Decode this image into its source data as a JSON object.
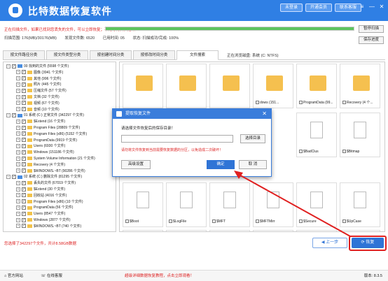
{
  "app": {
    "title": "比特数据恢复软件"
  },
  "titlebar": {
    "buttons": [
      "未登录",
      "开通会员",
      "联系客服"
    ],
    "win_controls": [
      "≡",
      "—",
      "✕"
    ]
  },
  "scan": {
    "status": "正在扫描文件，如果已找到您丢失的文件，可以立即恢复；不用等待扫描结束！",
    "progress": 1.0,
    "details": [
      "扫描范围: 176(MB)/30176(MB)",
      "发现文件数: 6520",
      "已用时间: 05",
      "状态: 扫描成功/完成: 100%"
    ],
    "pause_btn": "暂停扫描",
    "save_btn": "保存进度"
  },
  "tabs": [
    "按文件路径分类",
    "按文件类型分类",
    "按创建时间分类",
    "按修改时间分类",
    "文件搜索"
  ],
  "current_position": "正在浏览磁盘: 系统 (C: NTFS)",
  "tree": [
    {
      "label": "00 找到的文件 (5598 个文件)",
      "level": 0,
      "type": "blue"
    },
    {
      "label": "图像 (3941 个文件)",
      "level": 1,
      "type": "folder"
    },
    {
      "label": "其他 (996 个文件)",
      "level": 1,
      "type": "folder"
    },
    {
      "label": "照片 (445 个文件)",
      "level": 1,
      "type": "folder"
    },
    {
      "label": "压缩文件 (57 个文件)",
      "level": 1,
      "type": "folder"
    },
    {
      "label": "文档 (32 个文件)",
      "level": 1,
      "type": "folder"
    },
    {
      "label": "视频 (67 个文件)",
      "level": 1,
      "type": "folder"
    },
    {
      "label": "音频 (10 个文件)",
      "level": 1,
      "type": "folder"
    },
    {
      "label": "01 系统 (C:) 正常文件 (342297 个文件)",
      "level": 0,
      "type": "blue"
    },
    {
      "label": "$Extend (16 个文件)",
      "level": 1,
      "type": "folder"
    },
    {
      "label": "Program Files (28809 个文件)",
      "level": 1,
      "type": "folder"
    },
    {
      "label": "Program Files (x86) (5152 个文件)",
      "level": 1,
      "type": "folder"
    },
    {
      "label": "ProgramData (9919 个文件)",
      "level": 1,
      "type": "folder"
    },
    {
      "label": "Users (6930 个文件)",
      "level": 1,
      "type": "folder"
    },
    {
      "label": "Windows (151186 个文件)",
      "level": 1,
      "type": "folder"
    },
    {
      "label": "System Volume Information (21 个文件)",
      "level": 1,
      "type": "folder"
    },
    {
      "label": "Recovery (4 个文件)",
      "level": 1,
      "type": "folder"
    },
    {
      "label": "$WINDOWS.~BT (90286 个文件)",
      "level": 1,
      "type": "folder"
    },
    {
      "label": "02 系统 (C:) 删除文件 (81295 个文件)",
      "level": 0,
      "type": "blue"
    },
    {
      "label": "丢失的文件 (67019 个文件)",
      "level": 1,
      "type": "folder"
    },
    {
      "label": "$Extend (30 个文件)",
      "level": 1,
      "type": "folder"
    },
    {
      "label": "回收站 (4016 个文件)",
      "level": 1,
      "type": "folder"
    },
    {
      "label": "Program Files (x86) (10 个文件)",
      "level": 1,
      "type": "folder"
    },
    {
      "label": "ProgramData (56 个文件)",
      "level": 1,
      "type": "folder"
    },
    {
      "label": "Users (8547 个文件)",
      "level": 1,
      "type": "folder"
    },
    {
      "label": "Windows (2877 个文件)",
      "level": 1,
      "type": "folder"
    },
    {
      "label": "$WINDOWS.~BT (740 个文件)",
      "level": 1,
      "type": "folder"
    }
  ],
  "grid": {
    "row1": [
      "",
      "",
      "",
      "",
      "",
      "",
      ""
    ],
    "row1_caption": [
      "",
      "",
      "",
      "dows (151...",
      "ProgramData (99...",
      "Recovery (4 个..."
    ],
    "row2": [
      "$BadClus",
      "$Bitmap"
    ],
    "row3": [
      "$Boot",
      "$LogFile",
      "$MFT",
      "$MFTMirr",
      "$Secure",
      "$UpCase"
    ]
  },
  "dialog": {
    "title": "提取恢复文件",
    "prompt": "请选择文件恢复后的保存目录！",
    "input_value": "",
    "browse_btn": "选择目录",
    "warning": "请勿将文件恢复到当前需要恢复数据的分区，以免造成二次破坏！",
    "advanced_btn": "高级设置",
    "ok_btn": "确定",
    "cancel_btn": "取 消"
  },
  "selection_info": "您选择了342297个文件，共计8.58GB数据",
  "buttons": {
    "prev": "上一步",
    "recover": "恢复"
  },
  "statusbar": {
    "website": "官方网站",
    "support": "在线客服",
    "center_link": "超级详细数据恢复教程，点击立即观看！",
    "version": "版本: 8.3.5"
  },
  "colors": {
    "brand": "#2f7fe4",
    "danger": "#dd2222",
    "folder": "#f5c04f"
  }
}
